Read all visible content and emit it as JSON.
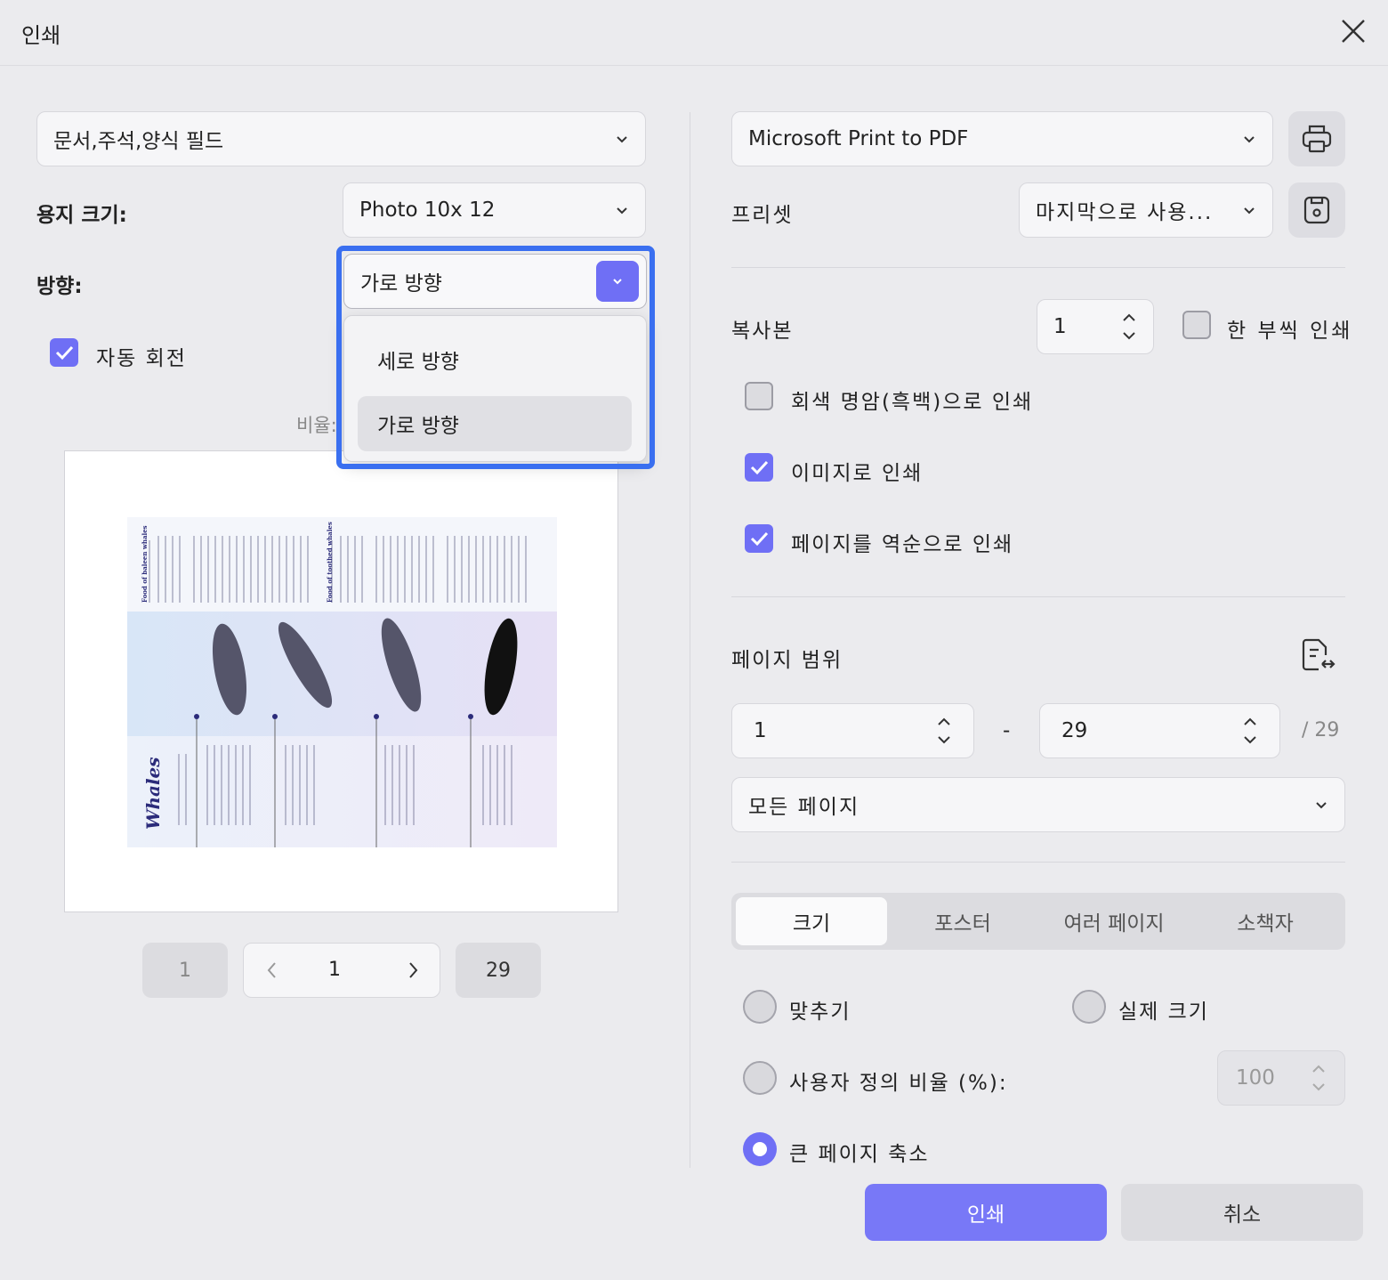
{
  "dialog": {
    "title": "인쇄"
  },
  "left": {
    "content_select": "문서,주석,양식 필드",
    "paper_size_label": "용지 크기:",
    "paper_size_value": "Photo 10x 12",
    "orientation_label": "방향:",
    "orientation_value": "가로 방향",
    "orientation_options": [
      "세로 방향",
      "가로 방향"
    ],
    "auto_rotate_label": "자동 회전",
    "auto_rotate_checked": true,
    "scale_label_partial": "비율:",
    "preview": {
      "title": "Whales",
      "heading_1": "Food of baleen whales",
      "heading_2": "Food of toothed whales"
    },
    "pager": {
      "first": "1",
      "current": "1",
      "last": "29"
    }
  },
  "right": {
    "printer": "Microsoft Print to PDF",
    "preset_label": "프리셋",
    "preset_value": "마지막으로 사용...",
    "copies_label": "복사본",
    "copies_value": "1",
    "collate_label": "한 부씩 인쇄",
    "collate_checked": false,
    "grayscale_label": "회색 명암(흑백)으로 인쇄",
    "grayscale_checked": false,
    "as_image_label": "이미지로 인쇄",
    "as_image_checked": true,
    "reverse_label": "페이지를 역순으로 인쇄",
    "reverse_checked": true,
    "page_range_label": "페이지 범위",
    "range_from": "1",
    "range_dash": "-",
    "range_to": "29",
    "range_total": "/ 29",
    "pages_select": "모든 페이지",
    "tabs": [
      "크기",
      "포스터",
      "여러 페이지",
      "소책자"
    ],
    "active_tab": "크기",
    "fit_label": "맞추기",
    "actual_size_label": "실제 크기",
    "custom_scale_label": "사용자 정의 비율 (%):",
    "custom_scale_value": "100",
    "shrink_label": "큰 페이지 축소",
    "selected_scaling": "큰 페이지 축소"
  },
  "footer": {
    "print_button": "인쇄",
    "cancel_button": "취소"
  },
  "colors": {
    "accent": "#6f6ff5",
    "highlight_outline": "#3a6ff0",
    "background": "#ebebee"
  }
}
